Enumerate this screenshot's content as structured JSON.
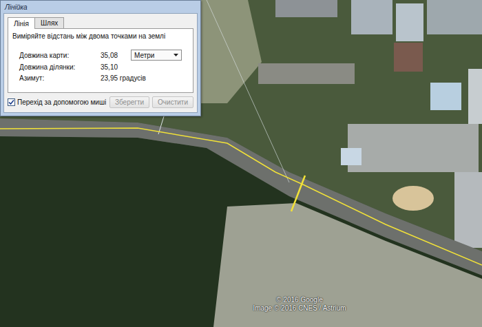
{
  "window": {
    "title": "Лінійка"
  },
  "tabs": [
    {
      "label": "Лінія",
      "selected": true
    },
    {
      "label": "Шлях",
      "selected": false
    }
  ],
  "instruction": "Виміряйте відстань між двома точками на землі",
  "measurements": [
    {
      "label": "Довжина карти:",
      "value": "35,08",
      "kind": "dropdown",
      "unit": "Метри"
    },
    {
      "label": "Довжина ділянки:",
      "value": "35,10",
      "kind": "plain",
      "unit": ""
    },
    {
      "label": "Азимут:",
      "value": "23,95 градусів",
      "kind": "plain",
      "unit": ""
    }
  ],
  "checkbox": {
    "label": "Перехід за допомогою миші",
    "checked": true
  },
  "buttons": [
    {
      "label": "Зберегти",
      "disabled": true
    },
    {
      "label": "Очистити",
      "disabled": true
    }
  ],
  "map": {
    "attribution": [
      "© 2016 Google",
      "Image © 2016 CNES / Astrium"
    ]
  }
}
